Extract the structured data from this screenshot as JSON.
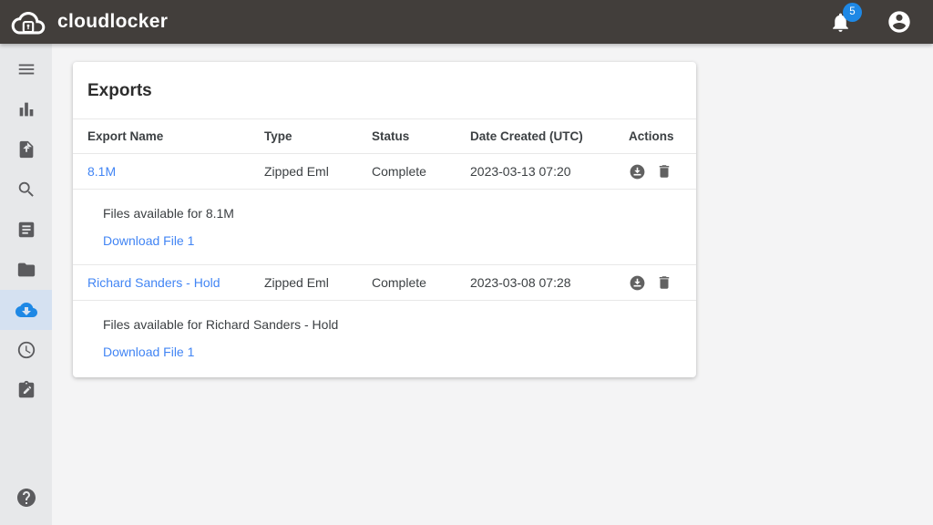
{
  "topbar": {
    "brand": "cloudlocker",
    "notification_count": "5",
    "icons": [
      "cloud-lock-logo",
      "bell-icon",
      "account-icon"
    ],
    "colors": {
      "bar_bg": "#423e3b",
      "badge": "#1e88e5"
    }
  },
  "sidebar": {
    "active_item": "exports-download",
    "active_color": "#1e88e5",
    "items": [
      {
        "icon": "menu-icon"
      },
      {
        "icon": "bar-chart-icon"
      },
      {
        "icon": "upload-file-icon"
      },
      {
        "icon": "search-icon"
      },
      {
        "icon": "document-icon"
      },
      {
        "icon": "folder-icon"
      },
      {
        "icon": "cloud-download-icon",
        "active": true
      },
      {
        "icon": "clock-icon"
      },
      {
        "icon": "clipboard-edit-icon"
      },
      {
        "icon": "help-icon"
      }
    ]
  },
  "exports_card": {
    "title": "Exports",
    "columns": [
      "Export Name",
      "Type",
      "Status",
      "Date Created (UTC)",
      "Actions"
    ],
    "link_color": "#4285f4",
    "rows": [
      {
        "name": "8.1M",
        "type": "Zipped Eml",
        "status": "Complete",
        "date_created": "2023-03-13 07:20",
        "row_actions": [
          "download",
          "delete"
        ],
        "files_text": "Files available for 8.1M",
        "download_links": [
          "Download File 1"
        ]
      },
      {
        "name": "Richard Sanders - Hold",
        "type": "Zipped Eml",
        "status": "Complete",
        "date_created": "2023-03-08 07:28",
        "row_actions": [
          "download",
          "delete"
        ],
        "files_text": "Files available for Richard Sanders - Hold",
        "download_links": [
          "Download File 1"
        ]
      }
    ]
  }
}
